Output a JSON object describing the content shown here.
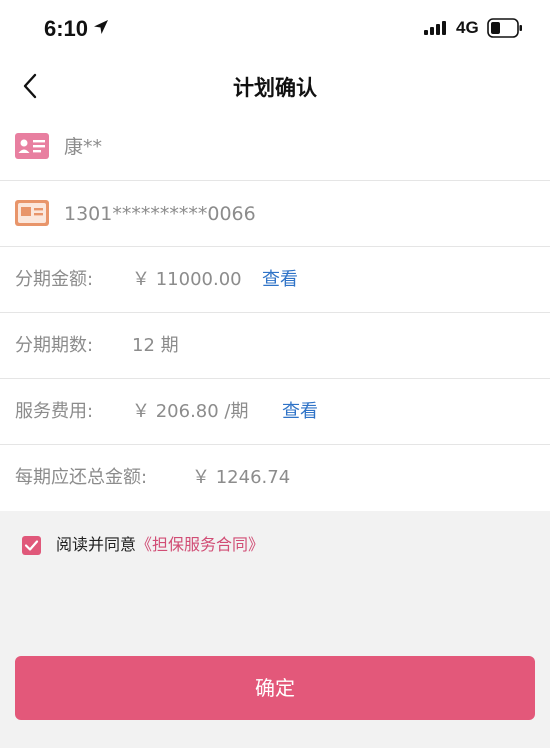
{
  "status_bar": {
    "time": "6:10",
    "network": "4G"
  },
  "header": {
    "title": "计划确认"
  },
  "user": {
    "name": "康**",
    "card_number": "1301**********0066"
  },
  "plan": {
    "amount_label": "分期金额:",
    "amount_value": "￥ 11000.00",
    "amount_link": "查看",
    "periods_label": "分期期数:",
    "periods_value": "12 期",
    "fee_label": "服务费用:",
    "fee_value": "￥ 206.80 /期",
    "fee_link": "查看",
    "total_label": "每期应还总金额:",
    "total_value": "￥ 1246.74"
  },
  "agreement": {
    "text": "阅读并同意",
    "contract": "《担保服务合同》",
    "checked": true
  },
  "confirm_button": {
    "label": "确定"
  },
  "colors": {
    "accent": "#e3587a",
    "link": "#2f73c7",
    "id_icon": "#e87fa0",
    "card_icon": "#e8956a"
  }
}
